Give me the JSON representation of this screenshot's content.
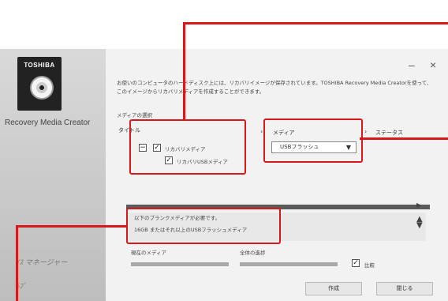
{
  "sidebar": {
    "logo_text": "TOSHIBA",
    "app_name": "Recovery Media Creator",
    "links": [
      "ｲｽ マネージャー",
      "ﾙﾌﾟ"
    ]
  },
  "window_controls": {
    "minimize": "–",
    "close": "×"
  },
  "description": "お使いのコンピュータのハードディスク上には、リカバリイメージが保存されています。TOSHIBA Recovery Media Creatorを使って、このイメージからリカバリメディアを作成することができます。",
  "media_select_header": "メディアの選択",
  "title_section": {
    "header": "タイトル",
    "items": [
      {
        "label": "リカバリメディア",
        "checked": true
      },
      {
        "label": "リカバリUSBメディア",
        "checked": true
      }
    ]
  },
  "media_section": {
    "header": "メディア",
    "selected": "USBフラッシュ"
  },
  "status_label": "ステータス",
  "message": {
    "line1": "以下のブランクメディアが必要です。",
    "line2": "16GB またはそれ以上のUSBフラッシュメディア"
  },
  "current_media_label": "現在のメディア",
  "overall_progress_label": "全体の進捗",
  "compare": {
    "label": "比較",
    "checked": true
  },
  "buttons": {
    "create": "作成",
    "close": "閉じる"
  },
  "colors": {
    "annotation": "#d7191c",
    "sidebar": "#c8c8c8"
  }
}
